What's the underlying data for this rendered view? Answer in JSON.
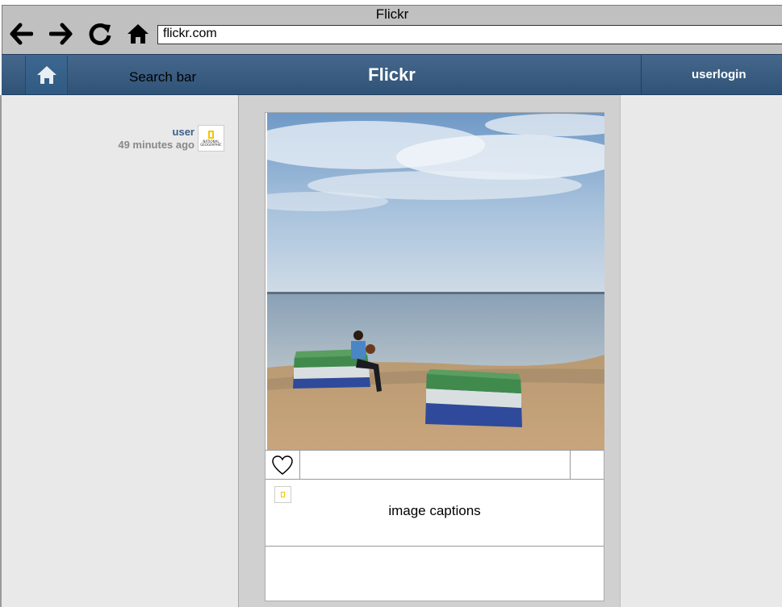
{
  "browser": {
    "title": "Flickr",
    "url": "flickr.com",
    "nav_icons": [
      "back-arrow-icon",
      "forward-arrow-icon",
      "reload-icon",
      "home-icon"
    ]
  },
  "header": {
    "home_icon": "home-icon",
    "search_label": "Search bar",
    "brand": "Flickr",
    "login_label": "userlogin"
  },
  "post": {
    "user": "user",
    "time": "49 minutes ago",
    "avatar_text": "NATIONAL GEOGRAPHIC",
    "like_icon": "heart-icon",
    "caption": "image captions"
  },
  "colors": {
    "header_bg": "#3a5f87",
    "panel_bg": "#e9e9e9",
    "center_bg": "#d0d0d0",
    "username": "#3a5f8a"
  }
}
